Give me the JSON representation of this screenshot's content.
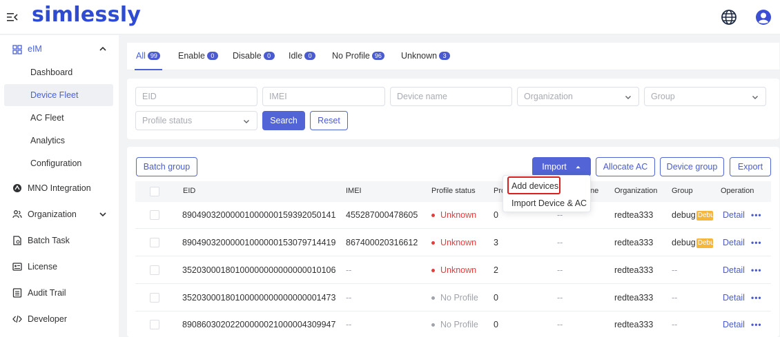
{
  "header": {
    "logo": "simlessly"
  },
  "sidebar": {
    "groups": [
      {
        "label": "eIM",
        "icon": "grid-icon",
        "expanded": true,
        "items": [
          {
            "label": "Dashboard"
          },
          {
            "label": "Device Fleet",
            "active": true
          },
          {
            "label": "AC Fleet"
          },
          {
            "label": "Analytics"
          },
          {
            "label": "Configuration"
          }
        ]
      },
      {
        "label": "MNO Integration",
        "icon": "signal-icon"
      },
      {
        "label": "Organization",
        "icon": "people-icon",
        "expandable": true
      },
      {
        "label": "Batch Task",
        "icon": "document-icon"
      },
      {
        "label": "License",
        "icon": "license-icon"
      },
      {
        "label": "Audit Trail",
        "icon": "list-icon"
      },
      {
        "label": "Developer",
        "icon": "code-icon"
      }
    ]
  },
  "tabs": [
    {
      "label": "All",
      "count": "99",
      "active": true
    },
    {
      "label": "Enable",
      "count": "0"
    },
    {
      "label": "Disable",
      "count": "0"
    },
    {
      "label": "Idle",
      "count": "0"
    },
    {
      "label": "No Profile",
      "count": "96"
    },
    {
      "label": "Unknown",
      "count": "3"
    }
  ],
  "filters": {
    "eid_placeholder": "EID",
    "imei_placeholder": "IMEI",
    "device_name_placeholder": "Device name",
    "organization_placeholder": "Organization",
    "group_placeholder": "Group",
    "profile_status_placeholder": "Profile status",
    "search_label": "Search",
    "reset_label": "Reset"
  },
  "toolbar": {
    "batch_group": "Batch group",
    "import": "Import",
    "allocate_ac": "Allocate AC",
    "device_group": "Device group",
    "export": "Export"
  },
  "import_menu": [
    "Add devices",
    "Import Device & AC"
  ],
  "table": {
    "columns": [
      "EID",
      "IMEI",
      "Profile status",
      "Pro",
      "ne",
      "Organization",
      "Group",
      "Operation"
    ],
    "rows": [
      {
        "eid": "89049032000001000000159392050141",
        "imei": "455287000478605",
        "status": "Unknown",
        "profiles": "0",
        "name": "--",
        "org": "redtea333",
        "group": "debug",
        "tag": "Debu"
      },
      {
        "eid": "89049032000001000000153079714419",
        "imei": "867400020316612",
        "status": "Unknown",
        "profiles": "3",
        "name": "--",
        "org": "redtea333",
        "group": "debug",
        "tag": "Debu"
      },
      {
        "eid": "35203000180100000000000000010106",
        "imei": "--",
        "status": "Unknown",
        "profiles": "2",
        "name": "--",
        "org": "redtea333",
        "group": "--",
        "tag": ""
      },
      {
        "eid": "35203000180100000000000000001473",
        "imei": "--",
        "status": "No Profile",
        "profiles": "0",
        "name": "--",
        "org": "redtea333",
        "group": "--",
        "tag": ""
      },
      {
        "eid": "89086030202200000021000004309947",
        "imei": "--",
        "status": "No Profile",
        "profiles": "0",
        "name": "--",
        "org": "redtea333",
        "group": "--",
        "tag": ""
      }
    ],
    "detail_label": "Detail",
    "more_label": "•••"
  },
  "colors": {
    "brand": "#2e4bd1",
    "primary": "#5264d6",
    "danger": "#e63b3b",
    "tag": "#f5b63a"
  }
}
